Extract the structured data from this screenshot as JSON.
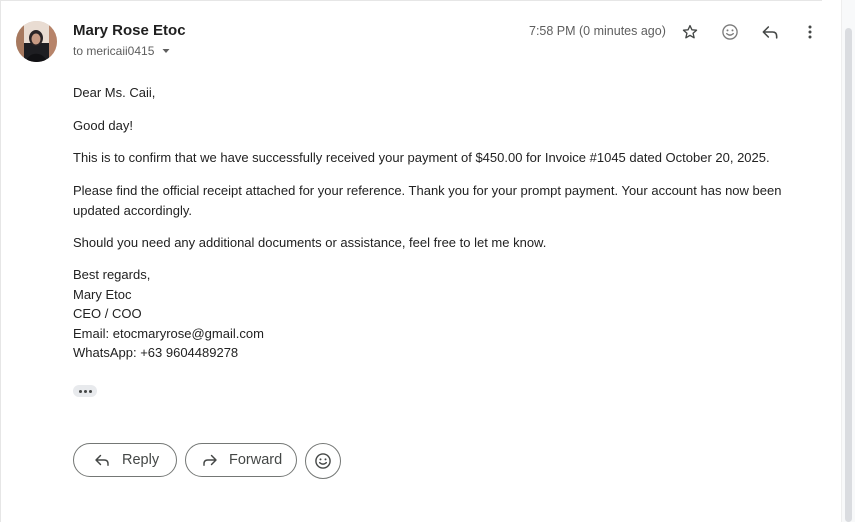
{
  "header": {
    "sender_name": "Mary Rose Etoc",
    "recipient_line": "to mericaii0415",
    "timestamp": "7:58 PM (0 minutes ago)",
    "icons": [
      "star-icon",
      "emoji-reaction-icon",
      "reply-icon",
      "more-options-icon"
    ]
  },
  "message": {
    "greeting": "Dear Ms. Caii,",
    "line1": "Good day!",
    "line2": "This is to confirm that we have successfully received your payment of $450.00 for Invoice #1045 dated October 20, 2025.",
    "line3": "Please find the official receipt attached for your reference. Thank you for your prompt payment. Your account has now been updated accordingly.",
    "line4": "Should you need any additional documents or assistance, feel free to let me know.",
    "signature": {
      "closing": "Best regards,",
      "name": "Mary Etoc",
      "title": "CEO / COO",
      "email": "Email: etocmaryrose@gmail.com",
      "whatsapp": "WhatsApp: +63 9604489278"
    }
  },
  "actions": {
    "reply_label": "Reply",
    "forward_label": "Forward"
  }
}
